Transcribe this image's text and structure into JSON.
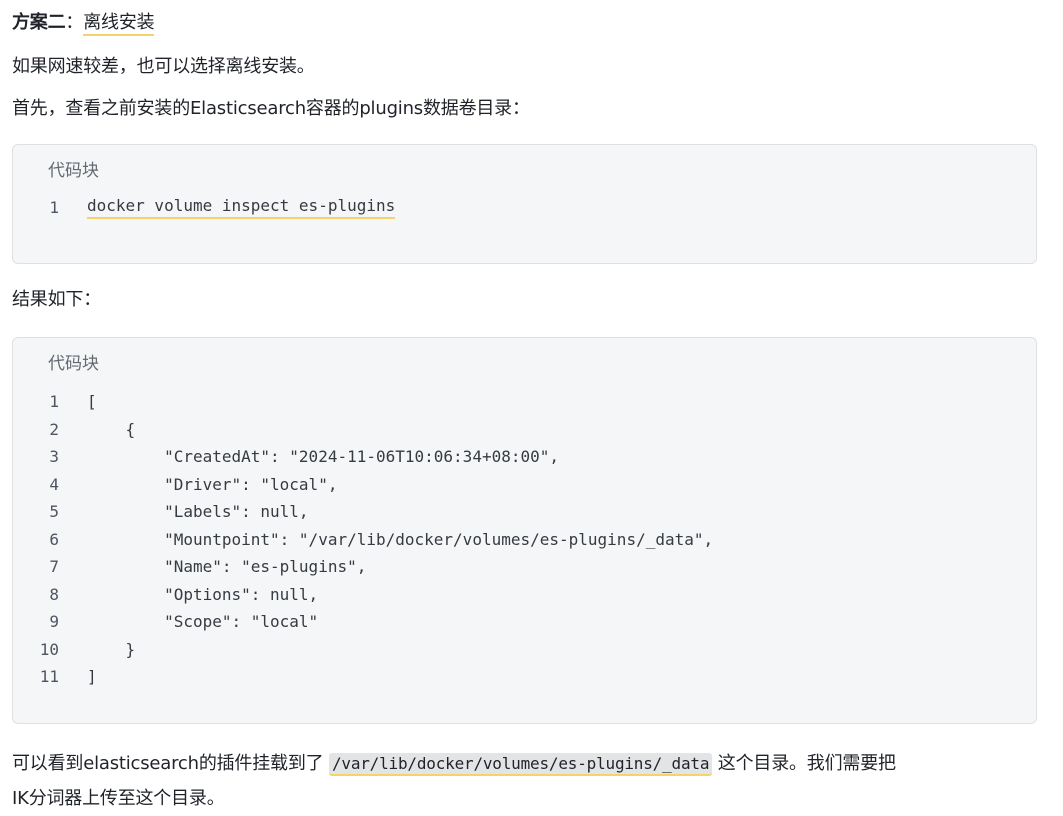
{
  "section": {
    "title_bold": "方案二",
    "title_colon": "：",
    "title_text": "离线安装"
  },
  "paragraphs": {
    "p1": "如果网速较差，也可以选择离线安装。",
    "p2": "首先，查看之前安装的Elasticsearch容器的plugins数据卷目录：",
    "p3": "结果如下：",
    "p4_before": "可以看到elasticsearch的插件挂载到了 ",
    "p4_code": "/var/lib/docker/volumes/es-plugins/_data",
    "p4_after": " 这个目录。我们需要把",
    "p4_line2": "IK分词器上传至这个目录。"
  },
  "code_block_1": {
    "header": "代码块",
    "lines": [
      {
        "num": "1",
        "text": "docker volume inspect es-plugins"
      }
    ]
  },
  "code_block_2": {
    "header": "代码块",
    "lines": [
      {
        "num": "1",
        "text": "["
      },
      {
        "num": "2",
        "text": "    {"
      },
      {
        "num": "3",
        "text": "        \"CreatedAt\": \"2024-11-06T10:06:34+08:00\","
      },
      {
        "num": "4",
        "text": "        \"Driver\": \"local\","
      },
      {
        "num": "5",
        "text": "        \"Labels\": null,"
      },
      {
        "num": "6",
        "text": "        \"Mountpoint\": \"/var/lib/docker/volumes/es-plugins/_data\","
      },
      {
        "num": "7",
        "text": "        \"Name\": \"es-plugins\","
      },
      {
        "num": "8",
        "text": "        \"Options\": null,"
      },
      {
        "num": "9",
        "text": "        \"Scope\": \"local\""
      },
      {
        "num": "10",
        "text": "    }"
      },
      {
        "num": "11",
        "text": "]"
      }
    ]
  }
}
